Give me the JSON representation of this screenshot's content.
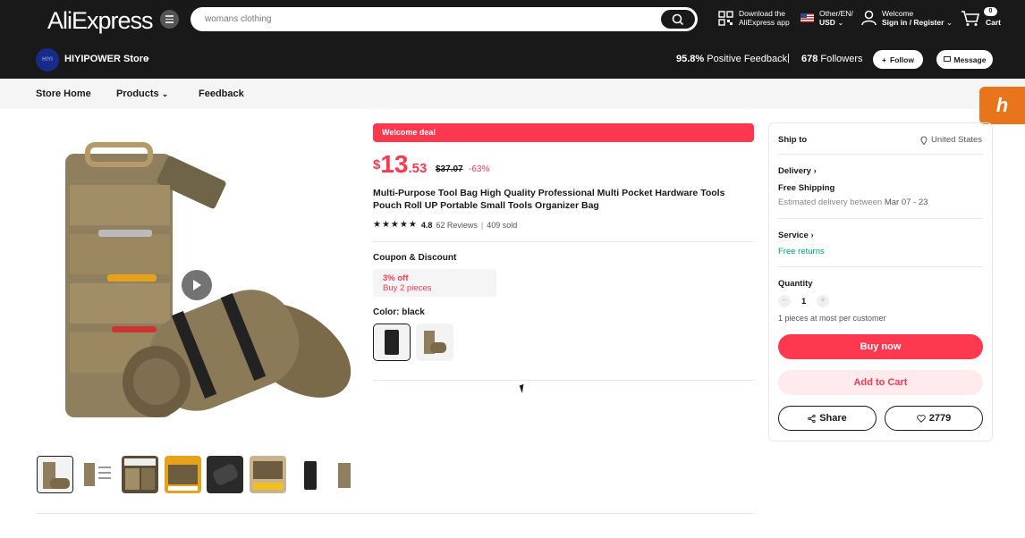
{
  "header": {
    "logo": "AliExpress",
    "search_placeholder": "womans clothing",
    "app_line1": "Download the",
    "app_line2": "AliExpress app",
    "locale_line1": "Other/EN/",
    "locale_line2": "USD",
    "account_line1": "Welcome",
    "account_line2": "Sign in / Register",
    "cart_count": "0",
    "cart_label": "Cart"
  },
  "store": {
    "name": "HIYIPOWER Store",
    "feedback_value": "95.8%",
    "feedback_label": "Positive Feedback",
    "separator": "|",
    "followers_value": "678",
    "followers_label": "Followers",
    "follow_label": "Follow",
    "message_label": "Message"
  },
  "nav": {
    "items": [
      "Store Home",
      "Products",
      "Feedback"
    ]
  },
  "product": {
    "deal_banner": "Welcome deal",
    "price_currency": "$",
    "price_int": "13",
    "price_dec": ".53",
    "old_price": "$37.07",
    "discount": "-63%",
    "title": "Multi-Purpose Tool Bag High Quality Professional Multi Pocket Hardware Tools Pouch Roll UP Portable Small Tools Organizer Bag",
    "rating": "4.8",
    "reviews": "62 Reviews",
    "sold": "409 sold",
    "coupon_heading": "Coupon & Discount",
    "coupon_title": "3% off",
    "coupon_sub": "Buy 2 pieces",
    "color_heading": "Color: black"
  },
  "buy_panel": {
    "ship_to_label": "Ship to",
    "ship_to_value": "United States",
    "delivery_label": "Delivery",
    "shipping": "Free Shipping",
    "estimate_prefix": "Estimated delivery between",
    "estimate_dates": "Mar 07 - 23",
    "service_label": "Service",
    "service_value": "Free returns",
    "quantity_label": "Quantity",
    "quantity_value": "1",
    "quantity_note": "1 pieces at most per customer",
    "buy_now": "Buy now",
    "add_to_cart": "Add to Cart",
    "share": "Share",
    "wishlist_count": "2779"
  },
  "colors": {
    "brand_red": "#fd384f",
    "header_bg": "#191919",
    "green": "#00a076",
    "honey": "#e8741c"
  },
  "icons": [
    "menu-icon",
    "search-icon",
    "qr-code-icon",
    "us-flag-icon",
    "user-icon",
    "cart-icon",
    "chevron-right-icon",
    "plus-icon",
    "message-icon",
    "chevron-down-icon",
    "play-icon",
    "star-icon",
    "location-pin-icon",
    "share-icon",
    "heart-icon",
    "honey-icon"
  ]
}
